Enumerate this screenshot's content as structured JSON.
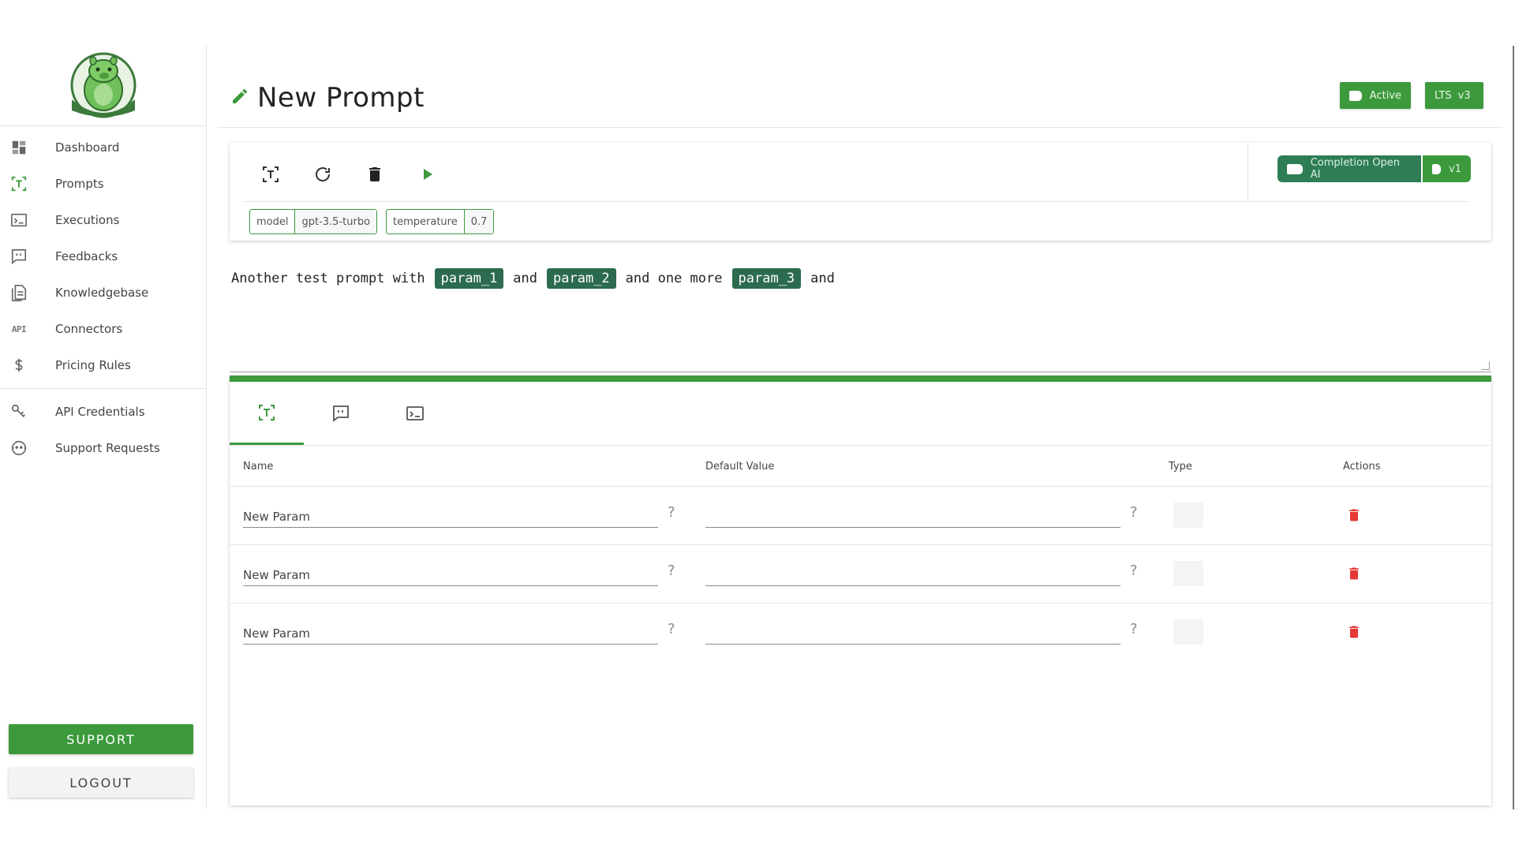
{
  "sidebar": {
    "items": [
      {
        "label": "Dashboard",
        "icon": "dashboard-icon"
      },
      {
        "label": "Prompts",
        "icon": "text-box-icon"
      },
      {
        "label": "Executions",
        "icon": "console-icon"
      },
      {
        "label": "Feedbacks",
        "icon": "feedback-icon"
      },
      {
        "label": "Knowledgebase",
        "icon": "document-icon"
      },
      {
        "label": "Connectors",
        "icon": "api-icon"
      },
      {
        "label": "Pricing Rules",
        "icon": "dollar-icon"
      },
      {
        "label": "API Credentials",
        "icon": "key-icon"
      },
      {
        "label": "Support Requests",
        "icon": "support-face-icon"
      }
    ],
    "api_text": "API",
    "support_label": "SUPPORT",
    "logout_label": "LOGOUT"
  },
  "header": {
    "title": "New Prompt",
    "status_badge": "Active",
    "lts_label": "LTS",
    "lts_version": "v3"
  },
  "toolbar": {
    "chips": [
      {
        "key": "model",
        "value": "gpt-3.5-turbo"
      },
      {
        "key": "temperature",
        "value": "0.7"
      }
    ],
    "model_tag": "Completion Open AI",
    "model_version": "v1"
  },
  "prompt": {
    "segments": [
      {
        "text": "Another test prompt with",
        "param": "param_1"
      },
      {
        "text": "and",
        "param": "param_2"
      },
      {
        "text": "and one more",
        "param": "param_3"
      },
      {
        "text": "and",
        "param": ""
      }
    ]
  },
  "params_table": {
    "headers": [
      "Name",
      "Default Value",
      "Type",
      "Actions"
    ],
    "rows": [
      {
        "name": "New Param",
        "default": ""
      },
      {
        "name": "New Param",
        "default": ""
      },
      {
        "name": "New Param",
        "default": ""
      }
    ],
    "help_mark": "?"
  },
  "colors": {
    "accent": "#3c9a3c",
    "param_chip": "#2c6b4f",
    "delete": "#e53935"
  }
}
